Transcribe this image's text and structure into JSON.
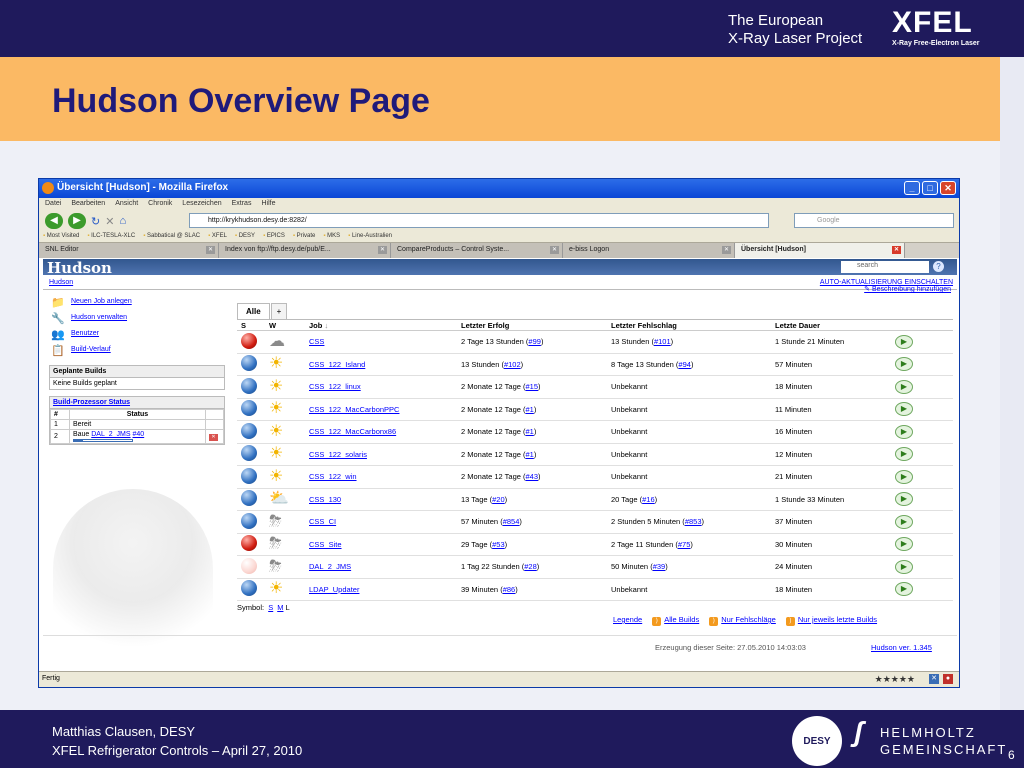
{
  "slide": {
    "tagline_line1": "The European",
    "tagline_line2": "X-Ray Laser Project",
    "logo": "XFEL",
    "logo_sub": "X-Ray Free-Electron Laser",
    "title": "Hudson Overview Page",
    "footer_line1": "Matthias Clausen, DESY",
    "footer_line2": "XFEL Refrigerator Controls – April 27, 2010",
    "page_number": "6",
    "desy_logo": "DESY",
    "helmholtz_line1": "HELMHOLTZ",
    "helmholtz_line2": "GEMEINSCHAFT"
  },
  "browser": {
    "window_title": "Übersicht [Hudson] - Mozilla Firefox",
    "menu": [
      "Datei",
      "Bearbeiten",
      "Ansicht",
      "Chronik",
      "Lesezeichen",
      "Extras",
      "Hilfe"
    ],
    "url": "http://krykhudson.desy.de:8282/",
    "search_placeholder": "Google",
    "bookmarks": [
      "Most Visited",
      "ILC-TESLA-XLC",
      "Sabbatical @ SLAC",
      "XFEL",
      "DESY",
      "EPICS",
      "Private",
      "MKS",
      "Line-Australien"
    ],
    "tabs": [
      {
        "label": "SNL Editor"
      },
      {
        "label": "Index von ftp://ftp.desy.de/pub/E..."
      },
      {
        "label": "CompareProducts – Control Syste..."
      },
      {
        "label": "e-biss Logon"
      },
      {
        "label": "Übersicht [Hudson]"
      }
    ],
    "status": "Fertig",
    "rating": "★★★★★"
  },
  "hudson": {
    "logo": "Hudson",
    "search_placeholder": "search",
    "help": "?",
    "breadcrumb": "Hudson",
    "auto_refresh": "AUTO-AKTUALISIERUNG EINSCHALTEN",
    "add_description": "Beschreibung hinzufügen",
    "sidebar": [
      {
        "label": "Neuen Job anlegen",
        "icon": "new-job-icon"
      },
      {
        "label": "Hudson verwalten",
        "icon": "wrench-icon"
      },
      {
        "label": "Benutzer",
        "icon": "users-icon"
      },
      {
        "label": "Build-Verlauf",
        "icon": "notepad-icon"
      }
    ],
    "queue": {
      "title": "Geplante Builds",
      "text": "Keine Builds geplant"
    },
    "executors": {
      "title": "Build-Prozessor Status",
      "col_num": "#",
      "col_status": "Status",
      "rows": [
        {
          "num": "1",
          "status": "Bereit",
          "build_prefix": "",
          "job": "",
          "build": ""
        },
        {
          "num": "2",
          "status": "",
          "build_prefix": "Baue ",
          "job": "DAL_2_JMS",
          "build": "#40",
          "progress": 0.15
        }
      ]
    },
    "view_tabs": [
      "Alle",
      "+"
    ],
    "table_headers": {
      "s": "S",
      "w": "W",
      "job": "Job",
      "job_sort": "↓",
      "last_success": "Letzter Erfolg",
      "last_failure": "Letzter Fehlschlag",
      "last_duration": "Letzte Dauer"
    },
    "jobs": [
      {
        "status": "red",
        "weather": "cloud",
        "name": "CSS",
        "ls_text": "2 Tage 13 Stunden (",
        "ls_build": "#99",
        "lf_text": "13 Stunden (",
        "lf_build": "#101",
        "duration": "1 Stunde 21 Minuten"
      },
      {
        "status": "blue",
        "weather": "sun",
        "name": "CSS_122_Island",
        "ls_text": "13 Stunden (",
        "ls_build": "#102",
        "lf_text": "8 Tage 13 Stunden (",
        "lf_build": "#94",
        "duration": "57 Minuten"
      },
      {
        "status": "blue",
        "weather": "sun",
        "name": "CSS_122_linux",
        "ls_text": "2 Monate 12 Tage (",
        "ls_build": "#15",
        "lf_text": "Unbekannt",
        "lf_build": "",
        "duration": "18 Minuten"
      },
      {
        "status": "blue",
        "weather": "sun",
        "name": "CSS_122_MacCarbonPPC",
        "ls_text": "2 Monate 12 Tage (",
        "ls_build": "#1",
        "lf_text": "Unbekannt",
        "lf_build": "",
        "duration": "11 Minuten"
      },
      {
        "status": "blue",
        "weather": "sun",
        "name": "CSS_122_MacCarbonx86",
        "ls_text": "2 Monate 12 Tage (",
        "ls_build": "#1",
        "lf_text": "Unbekannt",
        "lf_build": "",
        "duration": "16 Minuten"
      },
      {
        "status": "blue",
        "weather": "sun",
        "name": "CSS_122_solaris",
        "ls_text": "2 Monate 12 Tage (",
        "ls_build": "#1",
        "lf_text": "Unbekannt",
        "lf_build": "",
        "duration": "12 Minuten"
      },
      {
        "status": "blue",
        "weather": "sun",
        "name": "CSS_122_win",
        "ls_text": "2 Monate 12 Tage (",
        "ls_build": "#43",
        "lf_text": "Unbekannt",
        "lf_build": "",
        "duration": "21 Minuten"
      },
      {
        "status": "blue",
        "weather": "partly",
        "name": "CSS_130",
        "ls_text": "13 Tage (",
        "ls_build": "#20",
        "lf_text": "20 Tage (",
        "lf_build": "#16",
        "duration": "1 Stunde 33 Minuten"
      },
      {
        "status": "blue",
        "weather": "storm",
        "name": "CSS_CI",
        "ls_text": "57 Minuten (",
        "ls_build": "#854",
        "lf_text": "2 Stunden 5 Minuten (",
        "lf_build": "#853",
        "duration": "37 Minuten"
      },
      {
        "status": "red",
        "weather": "storm",
        "name": "CSS_Site",
        "ls_text": "29 Tage (",
        "ls_build": "#53",
        "lf_text": "2 Tage 11 Stunden (",
        "lf_build": "#75",
        "duration": "30 Minuten"
      },
      {
        "status": "pale",
        "weather": "storm",
        "name": "DAL_2_JMS",
        "ls_text": "1 Tag 22 Stunden (",
        "ls_build": "#28",
        "lf_text": "50 Minuten (",
        "lf_build": "#39",
        "duration": "24 Minuten"
      },
      {
        "status": "blue",
        "weather": "sun",
        "name": "LDAP_Updater",
        "ls_text": "39 Minuten (",
        "ls_build": "#86",
        "lf_text": "Unbekannt",
        "lf_build": "",
        "duration": "18 Minuten"
      }
    ],
    "symbol_label": "Symbol:",
    "symbol_sizes": [
      "S",
      "M",
      "L"
    ],
    "legend": "Legende",
    "feeds": [
      "Alle Builds",
      "Nur Fehlschläge",
      "Nur jeweils letzte Builds"
    ],
    "generated": "Erzeugung dieser Seite: 27.05.2010 14:03:03",
    "version": "Hudson ver. 1.345"
  }
}
